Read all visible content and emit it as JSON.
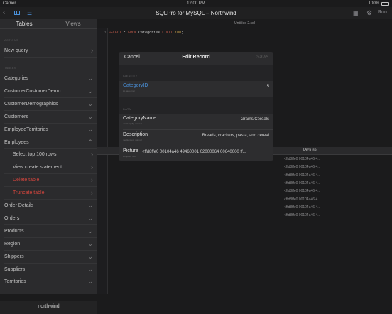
{
  "status_bar": {
    "carrier": "Carrier",
    "time": "12:00 PM",
    "battery": "100%"
  },
  "nav": {
    "title": "SQLPro for MySQL – Northwind",
    "run_label": "Run"
  },
  "sidebar": {
    "tabs": [
      "Tables",
      "Views"
    ],
    "actions_header": "ACTIONS",
    "new_query": "New query",
    "tables_header": "TABLES",
    "items": [
      {
        "label": "Categories",
        "chevron": "⌄"
      },
      {
        "label": "CustomerCustomerDemo",
        "chevron": "⌄"
      },
      {
        "label": "CustomerDemographics",
        "chevron": "⌄"
      },
      {
        "label": "Customers",
        "chevron": "⌄"
      },
      {
        "label": "EmployeeTerritories",
        "chevron": "⌄"
      },
      {
        "label": "Employees",
        "chevron": "⌃"
      },
      {
        "label": "Select top 100 rows",
        "chevron": "›"
      },
      {
        "label": "View create statement",
        "chevron": "›"
      },
      {
        "label": "Delete table",
        "chevron": "›"
      },
      {
        "label": "Truncate table",
        "chevron": "›"
      },
      {
        "label": "Order Details",
        "chevron": "⌄"
      },
      {
        "label": "Orders",
        "chevron": "⌄"
      },
      {
        "label": "Products",
        "chevron": "⌄"
      },
      {
        "label": "Region",
        "chevron": "⌄"
      },
      {
        "label": "Shippers",
        "chevron": "⌄"
      },
      {
        "label": "Suppliers",
        "chevron": "⌄"
      },
      {
        "label": "Territories",
        "chevron": "⌄"
      }
    ],
    "footer": "northwind"
  },
  "editor": {
    "doc_title": "Untitled 2.sql",
    "line_number": "1",
    "code": {
      "select": "SELECT",
      "star": " * ",
      "from": "FROM",
      "table": " Categories ",
      "limit": "LIMIT",
      "num": " 100",
      "end": ";"
    }
  },
  "results": {
    "column_header": "Picture",
    "cells": [
      "<ffd8ffe0 00104a46 4...",
      "<ffd8ffe0 00104a46 4...",
      "<ffd8ffe0 00104a46 4...",
      "<ffd8ffe0 00104a46 4...",
      "<ffd8ffe0 00104a46 4...",
      "<ffd8ffe0 00104a46 4...",
      "<ffd8ffe0 00104a46 4...",
      "<ffd8ffe0 00104a46 4..."
    ]
  },
  "modal": {
    "cancel": "Cancel",
    "title": "Edit Record",
    "save": "Save",
    "identity_header": "IDENTITY",
    "data_header": "DATA",
    "fields": {
      "category_id": {
        "name": "CategoryID",
        "type": "int, auto_incr",
        "value": "5"
      },
      "category_name": {
        "name": "CategoryName",
        "type": "varchar(15), not null",
        "value": "Grains/Cereals"
      },
      "description": {
        "name": "Description",
        "type": "mediumtext, not null",
        "value": "Breads, crackers, pasta, and cereal"
      },
      "picture": {
        "name": "Picture",
        "type": "longblob, null",
        "value": "<ffd8ffe0 00104a46 49460001 02000064 00640000 ff..."
      }
    }
  },
  "colors": {
    "accent": "#4a90d9",
    "destructive": "#d0453d",
    "background": "#1b1b1c"
  }
}
